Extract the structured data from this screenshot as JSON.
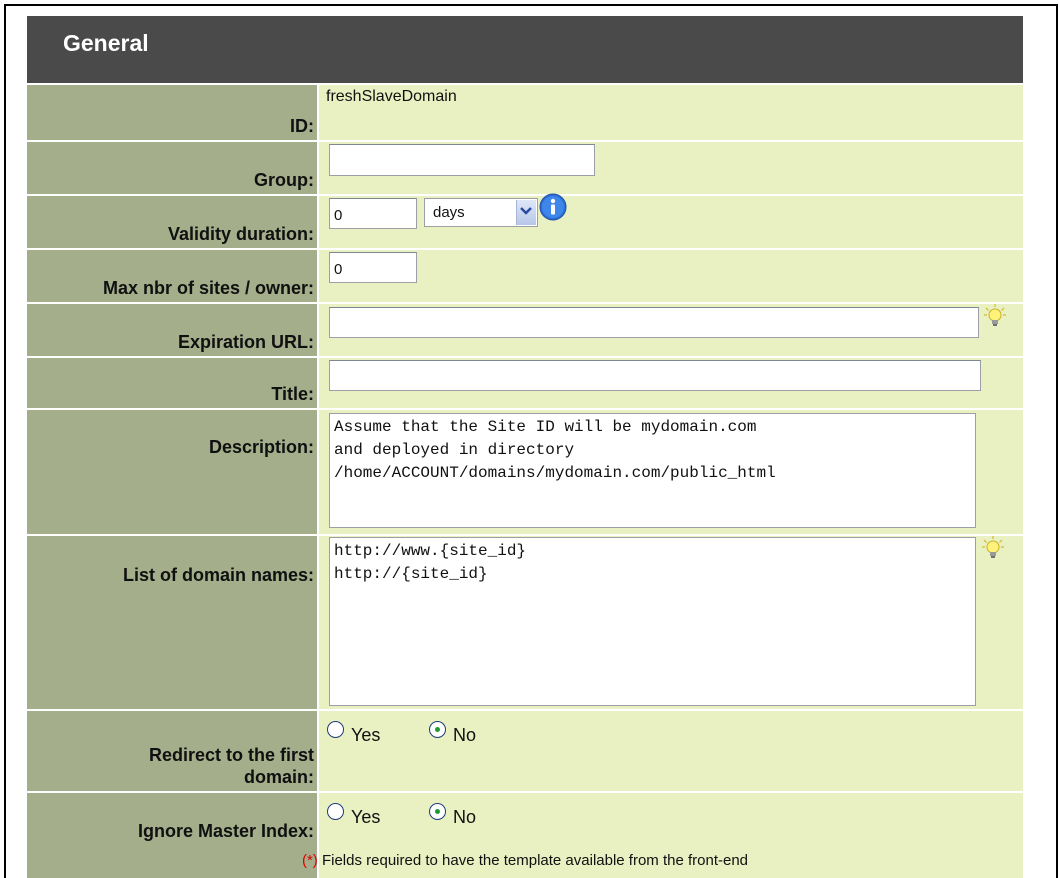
{
  "header": {
    "title": "General"
  },
  "fields": {
    "id": {
      "label": "ID:",
      "value": "freshSlaveDomain"
    },
    "group": {
      "label": "Group:",
      "value": ""
    },
    "validity": {
      "label": "Validity duration:",
      "value": "0",
      "unit": "days"
    },
    "max_sites": {
      "label": "Max nbr of sites / owner:",
      "value": "0"
    },
    "expiration_url": {
      "label": "Expiration URL:",
      "value": ""
    },
    "title": {
      "label": "Title:",
      "value": ""
    },
    "description": {
      "label": "Description:",
      "value": "Assume that the Site ID will be mydomain.com\nand deployed in directory\n/home/ACCOUNT/domains/mydomain.com/public_html"
    },
    "domain_names": {
      "label": "List of domain names:",
      "value": "http://www.{site_id}\nhttp://{site_id}"
    },
    "redirect_first": {
      "label": "Redirect to the first domain:",
      "yes_label": "Yes",
      "no_label": "No",
      "selected": "No"
    },
    "ignore_master": {
      "label": "Ignore Master Index:",
      "yes_label": "Yes",
      "no_label": "No",
      "selected": "No"
    }
  },
  "footnote": {
    "marker": "(*)",
    "text": "Fields required to have the template available from the front-end"
  },
  "icons": {
    "info": "info-icon",
    "hint": "lightbulb-icon"
  },
  "colors": {
    "header_bg": "#4a4a4a",
    "label_bg": "#a4ae8a",
    "value_bg": "#e9f0c2"
  }
}
